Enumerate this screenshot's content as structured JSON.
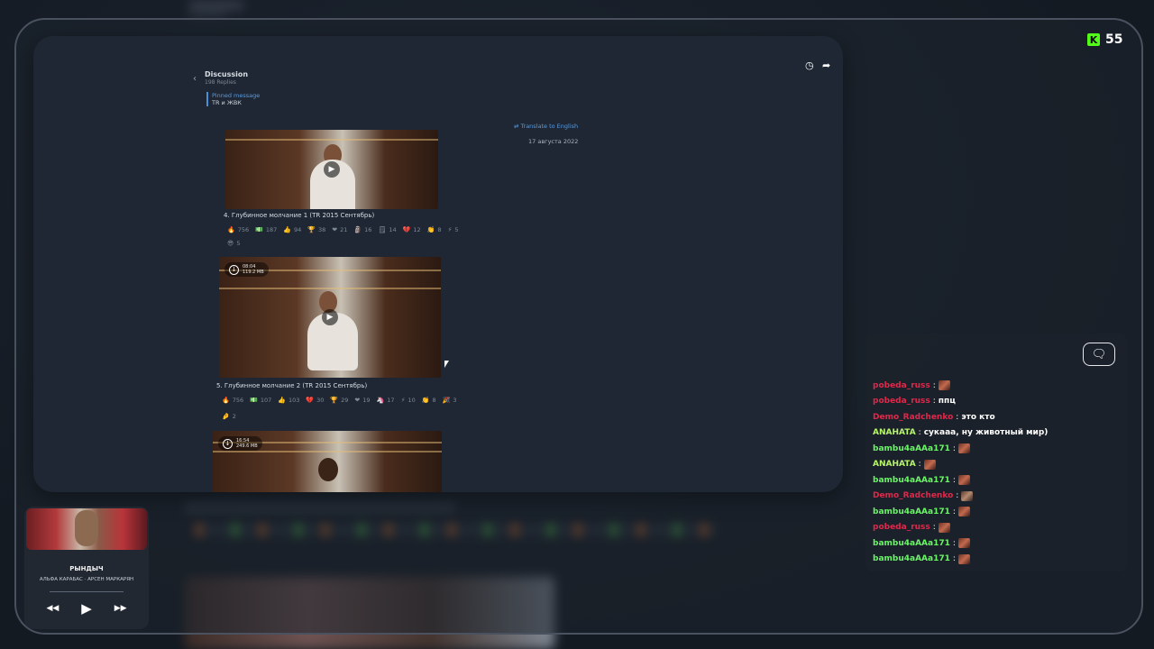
{
  "stream": {
    "viewer_count": "55"
  },
  "discussion": {
    "title": "Discussion",
    "replies": "198 Replies",
    "pinned_label": "Pinned message",
    "pinned_text": "TR и ЖВК",
    "translate": "Translate to English",
    "date": "17 августа 2022"
  },
  "posts": [
    {
      "caption": "4. Глубинное молчание 1 (TR 2015 Сентябрь)",
      "reactions_row1": [
        {
          "emoji": "🔥",
          "count": "756"
        },
        {
          "emoji": "💵",
          "count": "187"
        },
        {
          "emoji": "👍",
          "count": "94"
        },
        {
          "emoji": "🏆",
          "count": "38"
        },
        {
          "emoji": "❤",
          "count": "21"
        },
        {
          "emoji": "🗿",
          "count": "16"
        },
        {
          "emoji": "🗒",
          "count": "14"
        },
        {
          "emoji": "💔",
          "count": "12"
        },
        {
          "emoji": "👏",
          "count": "8"
        },
        {
          "emoji": "⚡",
          "count": "5"
        }
      ],
      "reactions_row2": [
        {
          "emoji": "😎",
          "count": "5"
        }
      ]
    },
    {
      "duration": "08:04",
      "size": "119.2 MB",
      "caption": "5. Глубинное молчание 2 (TR 2015 Сентябрь)",
      "reactions_row1": [
        {
          "emoji": "🔥",
          "count": "756"
        },
        {
          "emoji": "💵",
          "count": "107"
        },
        {
          "emoji": "👍",
          "count": "103"
        },
        {
          "emoji": "💔",
          "count": "30"
        },
        {
          "emoji": "🏆",
          "count": "29"
        },
        {
          "emoji": "❤",
          "count": "19"
        },
        {
          "emoji": "🦄",
          "count": "17"
        },
        {
          "emoji": "⚡",
          "count": "10"
        },
        {
          "emoji": "👏",
          "count": "8"
        },
        {
          "emoji": "🎉",
          "count": "3"
        }
      ],
      "reactions_row2": [
        {
          "emoji": "🤌",
          "count": "2"
        }
      ]
    },
    {
      "duration": "16:54",
      "size": "249.6 MB"
    }
  ],
  "chat": {
    "messages": [
      {
        "user": "pobeda_russ",
        "color": "#e0284a",
        "text": "",
        "emote": true
      },
      {
        "user": "pobeda_russ",
        "color": "#e0284a",
        "text": "ппц",
        "emote": false
      },
      {
        "user": "Demo_Radchenko",
        "color": "#e0284a",
        "text": "это кто",
        "emote": false
      },
      {
        "user": "ANAHATA",
        "color": "#b7f56a",
        "text": "сукааа, ну животный мир)",
        "emote": false
      },
      {
        "user": "bambu4aAAa171",
        "color": "#6af567",
        "text": "",
        "emote": true
      },
      {
        "user": "ANAHATA",
        "color": "#b7f56a",
        "text": "",
        "emote": true
      },
      {
        "user": "bambu4aAAa171",
        "color": "#6af567",
        "text": "",
        "emote": true
      },
      {
        "user": "Demo_Radchenko",
        "color": "#e0284a",
        "text": "",
        "emote": true
      },
      {
        "user": "bambu4aAAa171",
        "color": "#6af567",
        "text": "",
        "emote": true
      },
      {
        "user": "pobeda_russ",
        "color": "#e0284a",
        "text": "",
        "emote": true
      },
      {
        "user": "bambu4aAAa171",
        "color": "#6af567",
        "text": "",
        "emote": true
      },
      {
        "user": "bambu4aAAa171",
        "color": "#6af567",
        "text": "",
        "emote": true
      }
    ]
  },
  "player": {
    "track": "РЫНДЫЧ",
    "artist": "АЛЬФА КАРАБАС · АРСЕН МАРКАРЯН"
  }
}
